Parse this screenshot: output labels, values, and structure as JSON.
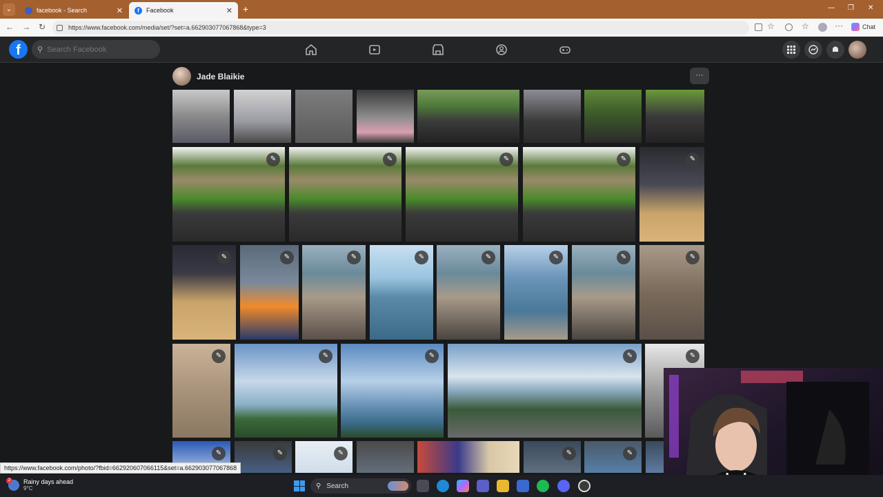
{
  "browser": {
    "tabs": [
      {
        "label": "facebook - Search",
        "active": false
      },
      {
        "label": "Facebook",
        "active": true
      }
    ],
    "url": "https://www.facebook.com/media/set/?set=a.662903077067868&type=3",
    "copilot_label": "Chat",
    "status_url": "https://www.facebook.com/photo/?fbid=662920607066115&set=a.662903077067868"
  },
  "fb": {
    "logo_letter": "f",
    "search_placeholder": "Search Facebook",
    "nav_icons": [
      "home-icon",
      "video-icon",
      "marketplace-icon",
      "groups-icon",
      "gaming-icon"
    ],
    "right_icons": [
      "menu-grid-icon",
      "messenger-icon",
      "notifications-icon",
      "account-avatar"
    ]
  },
  "album": {
    "owner_name": "Jade Blaikie",
    "more_label": "···"
  },
  "taskbar": {
    "weather_title": "Rainy days ahead",
    "weather_temp": "9°C",
    "weather_badge": "2",
    "search_label": "Search"
  },
  "colors": {
    "fb_blue": "#1877f2",
    "fb_bg": "#18191a",
    "fb_header": "#242526",
    "tabbar": "#a4602f"
  }
}
